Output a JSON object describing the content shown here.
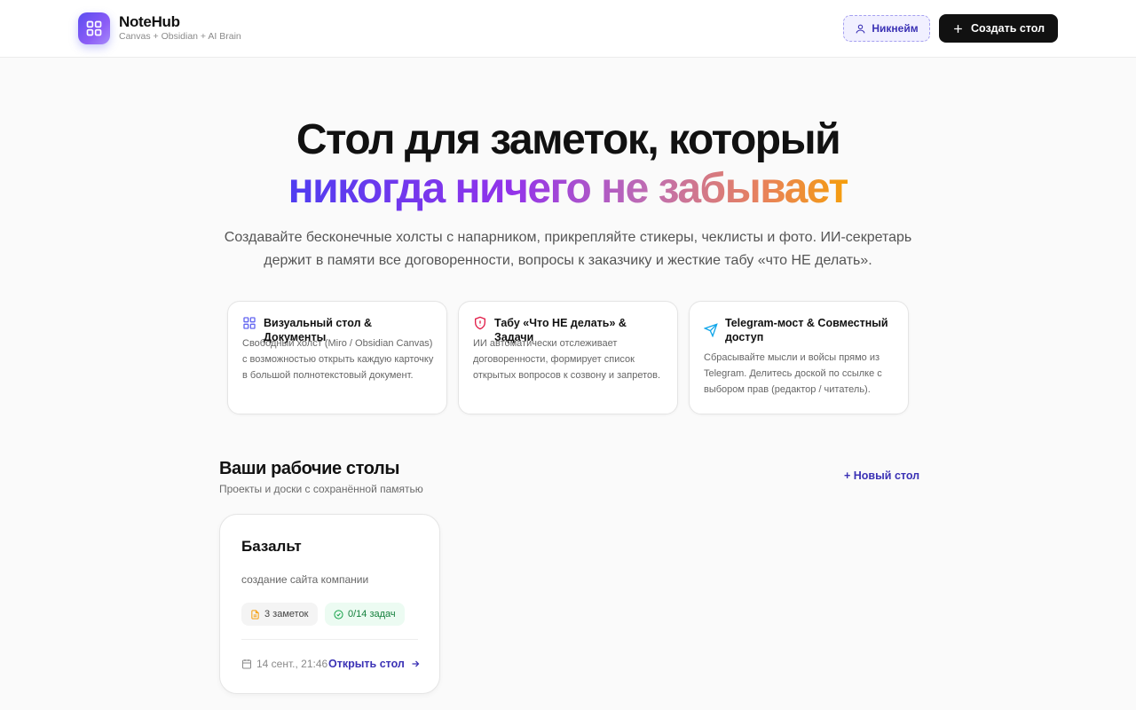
{
  "header": {
    "brand_name": "NoteHub",
    "brand_sub": "Canvas + Obsidian + AI Brain",
    "nickname_label": "Никнейм",
    "create_label": "Создать стол"
  },
  "hero": {
    "title_line1": "Стол для заметок, который",
    "title_line2": "никогда ничего не забывает",
    "subtitle": "Создавайте бесконечные холсты с напарником, прикрепляйте стикеры, чеклисты и фото. ИИ-секретарь держит в памяти все договоренности, вопросы к заказчику и жесткие табу «что НЕ делать»."
  },
  "features": [
    {
      "icon": "grid-icon",
      "title": "Визуальный стол & Документы",
      "description": "Свободный холст (Miro / Obsidian Canvas) с возможностью открыть каждую карточку в большой полнотекстовый документ."
    },
    {
      "icon": "shield-alert-icon",
      "title": "Табу «Что НЕ делать» & Задачи",
      "description": "ИИ автоматически отслеживает договоренности, формирует список открытых вопросов к созвону и запретов."
    },
    {
      "icon": "send-icon",
      "title": "Telegram-мост & Совместный доступ",
      "description": "Сбрасывайте мысли и войсы прямо из Telegram. Делитесь доской по ссылке с выбором прав (редактор / читатель)."
    }
  ],
  "boards_section": {
    "title": "Ваши рабочие столы",
    "subtitle": "Проекты и доски с сохранённой памятью",
    "new_board_label": "+ Новый стол"
  },
  "boards": [
    {
      "name": "Базальт",
      "description": "создание сайта компании",
      "notes_label": "3 заметок",
      "tasks_label": "0/14 задач",
      "date": "14 сент., 21:46",
      "open_label": "Открыть стол"
    }
  ],
  "colors": {
    "accent": "#3b32b5",
    "primary_button": "#111111",
    "gradient_start": "#4f3df0",
    "gradient_end": "#f59e0b",
    "task_chip": "#15803d"
  }
}
